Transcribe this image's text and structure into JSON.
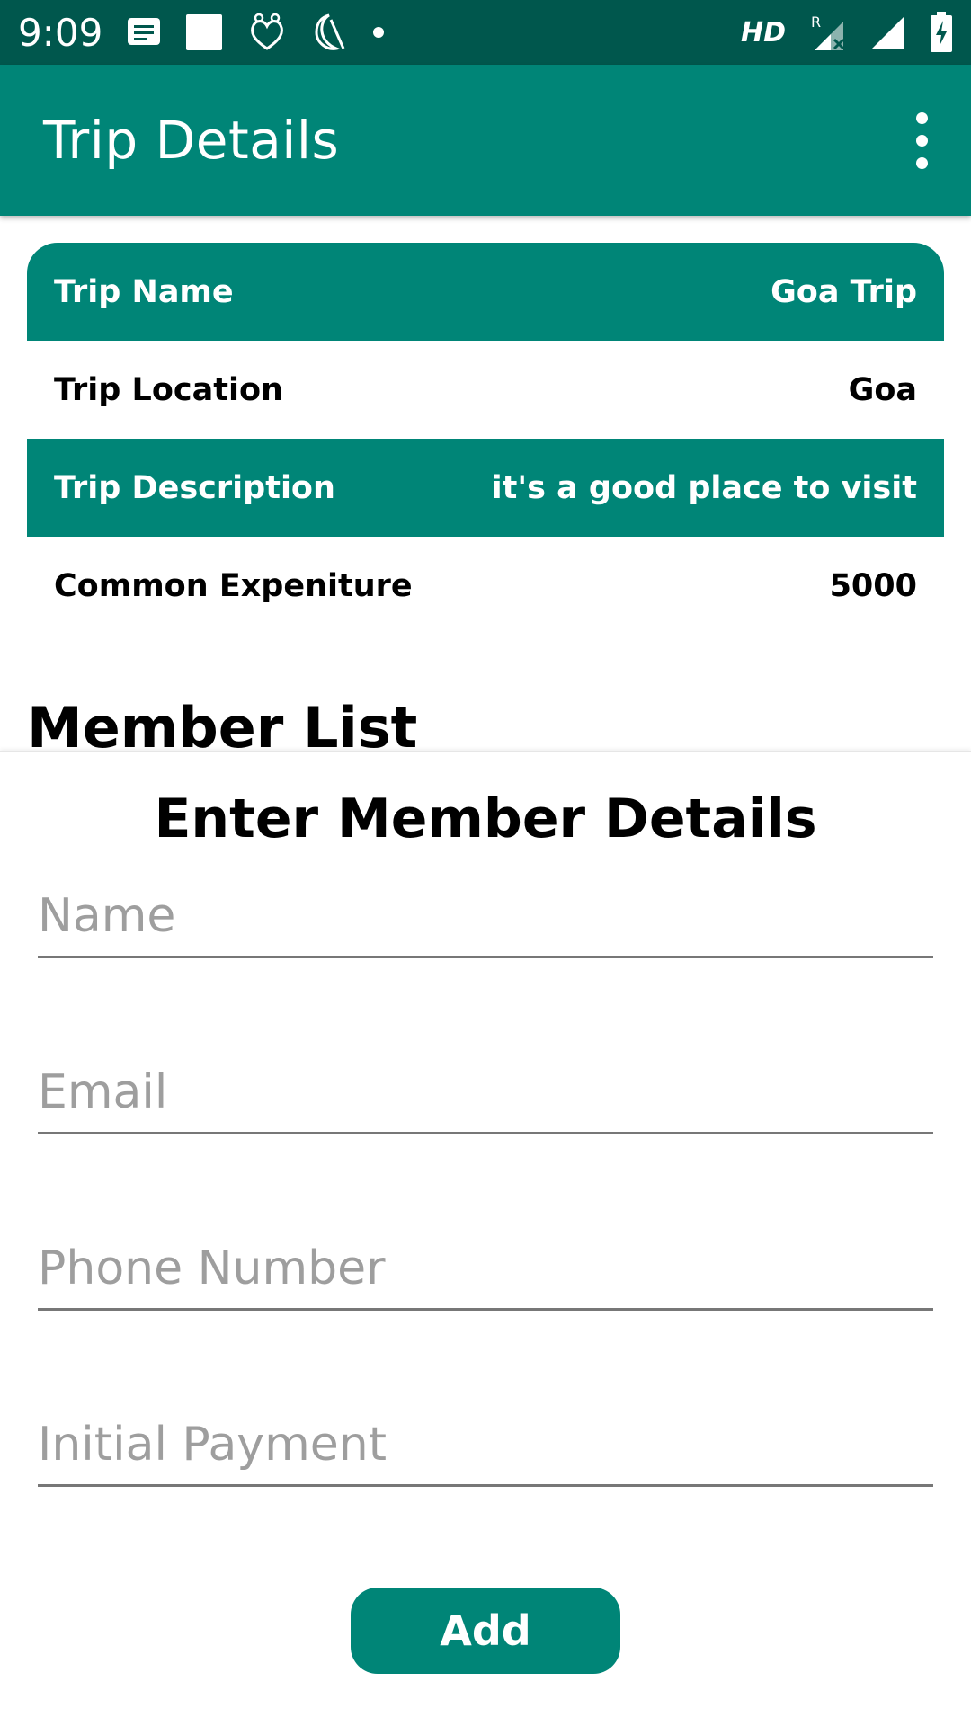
{
  "status_bar": {
    "time": "9:09",
    "hd_label": "HD",
    "roaming_label": "R",
    "icons": [
      "message-icon",
      "square-notification-icon",
      "hearts-icon",
      "moon-icon",
      "dot-icon",
      "signal-roaming-icon",
      "signal-icon",
      "battery-charging-icon"
    ]
  },
  "app_bar": {
    "title": "Trip Details",
    "menu_icon": "overflow-menu-icon"
  },
  "trip_details": [
    {
      "label": "Trip Name",
      "value": "Goa Trip"
    },
    {
      "label": "Trip Location",
      "value": "Goa"
    },
    {
      "label": "Trip Description",
      "value": "it's a good place to visit"
    },
    {
      "label": "Common Expeniture",
      "value": "5000"
    }
  ],
  "member_list": {
    "title": "Member List"
  },
  "member_form": {
    "title": "Enter Member Details",
    "name_placeholder": "Name",
    "email_placeholder": "Email",
    "phone_placeholder": "Phone Number",
    "payment_placeholder": "Initial Payment",
    "add_label": "Add"
  },
  "colors": {
    "primary": "#008577",
    "primary_dark": "#00574d",
    "text": "#000000",
    "hint": "#9e9e9e"
  }
}
